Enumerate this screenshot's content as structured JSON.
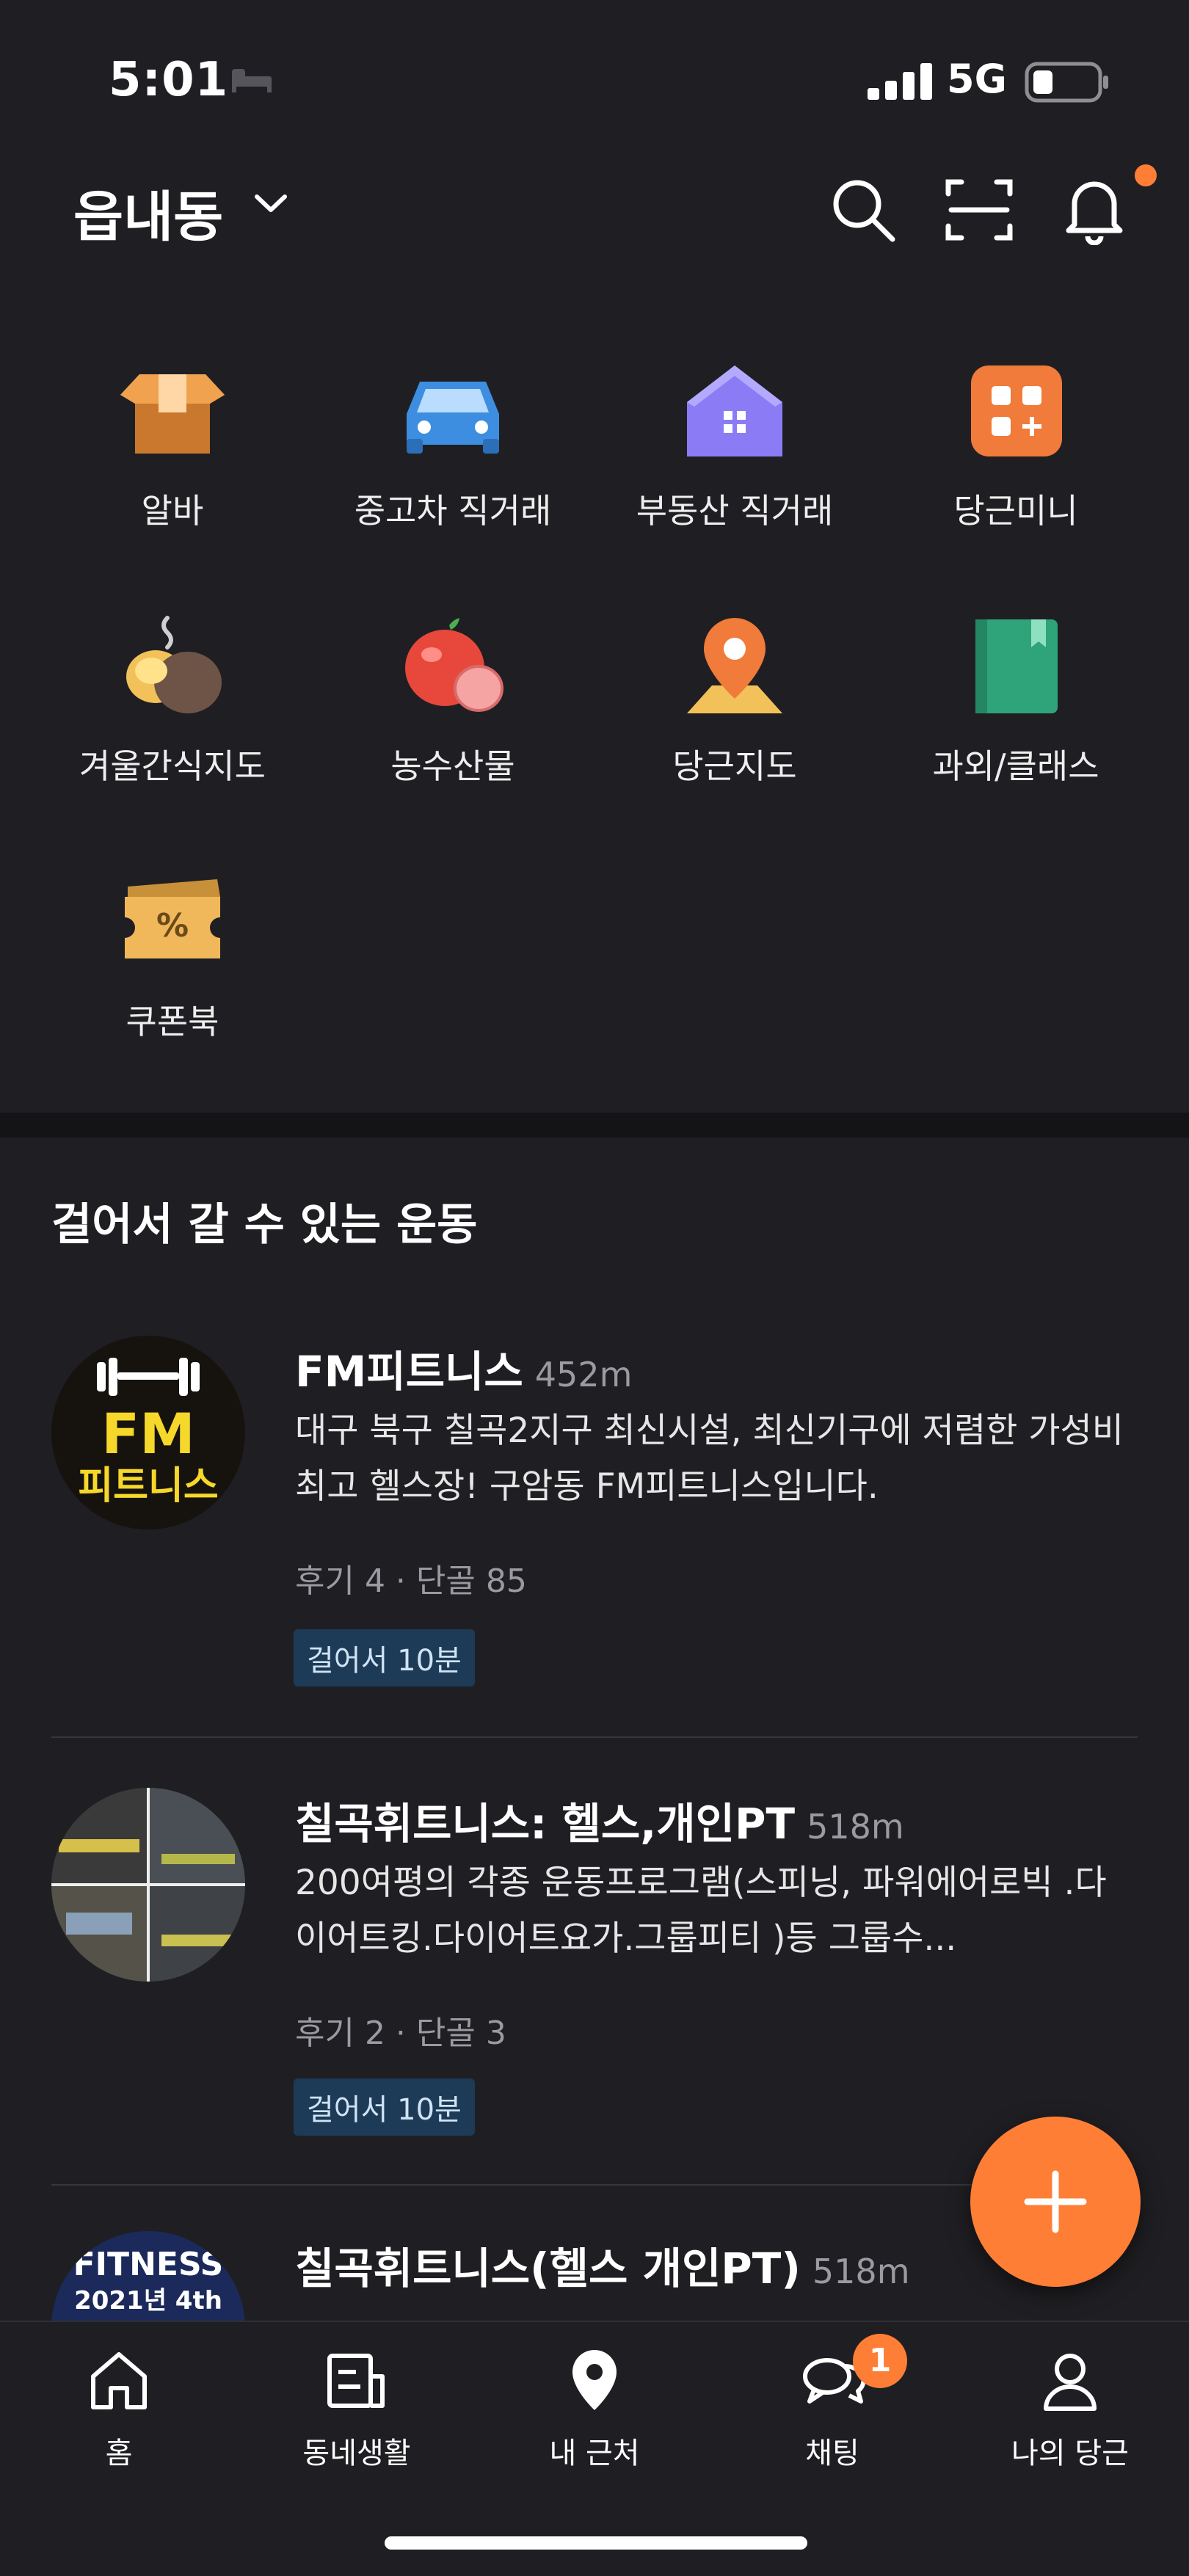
{
  "status_bar": {
    "time": "5:01",
    "network": "5G"
  },
  "header": {
    "location": "읍내동"
  },
  "services": [
    {
      "label": "알바",
      "icon": "job-box-icon"
    },
    {
      "label": "중고차 직거래",
      "icon": "car-icon"
    },
    {
      "label": "부동산 직거래",
      "icon": "house-icon"
    },
    {
      "label": "당근미니",
      "icon": "mini-apps-icon"
    },
    {
      "label": "겨울간식지도",
      "icon": "roasted-sweet-potato-icon"
    },
    {
      "label": "농수산물",
      "icon": "apple-icon"
    },
    {
      "label": "당근지도",
      "icon": "map-pin-icon"
    },
    {
      "label": "과외/클래스",
      "icon": "book-icon"
    },
    {
      "label": "쿠폰북",
      "icon": "coupon-icon"
    }
  ],
  "section": {
    "title": "걸어서 갈 수 있는 운동"
  },
  "listings": [
    {
      "title": "FM피트니스",
      "distance": "452m",
      "description": "대구 북구 칠곡2지구 최신시설, 최신기구에 저렴한 가성비 최고 헬스장! 구암동 FM피트니스입니다.",
      "meta": "후기 4 · 단골 85",
      "badge": "걸어서 10분",
      "thumb_text_top": "FM",
      "thumb_text_bottom": "피트니스"
    },
    {
      "title": "칠곡휘트니스: 헬스,개인PT",
      "distance": "518m",
      "description": "200여평의 각종 운동프로그램(스피닝, 파워에어로빅 .다이어트킹.다이어트요가.그룹피티 )등 그룹수...",
      "meta": "후기 2 · 단골 3",
      "badge": "걸어서 10분"
    },
    {
      "title": "칠곡휘트니스(헬스 개인PT)",
      "distance": "518m",
      "thumb_text_top": "FITNESS",
      "thumb_text_bottom": "2021년 4th"
    }
  ],
  "bottom_nav": [
    {
      "label": "홈",
      "icon": "home-icon"
    },
    {
      "label": "동네생활",
      "icon": "neighborhood-icon"
    },
    {
      "label": "내 근처",
      "icon": "location-pin-icon"
    },
    {
      "label": "채팅",
      "icon": "chat-icon"
    },
    {
      "label": "나의 당근",
      "icon": "profile-icon"
    }
  ],
  "chat_badge_count": "1",
  "colors": {
    "accent": "#ff7e36",
    "background": "#1f1f23",
    "badge_bg": "#1d3b56"
  }
}
